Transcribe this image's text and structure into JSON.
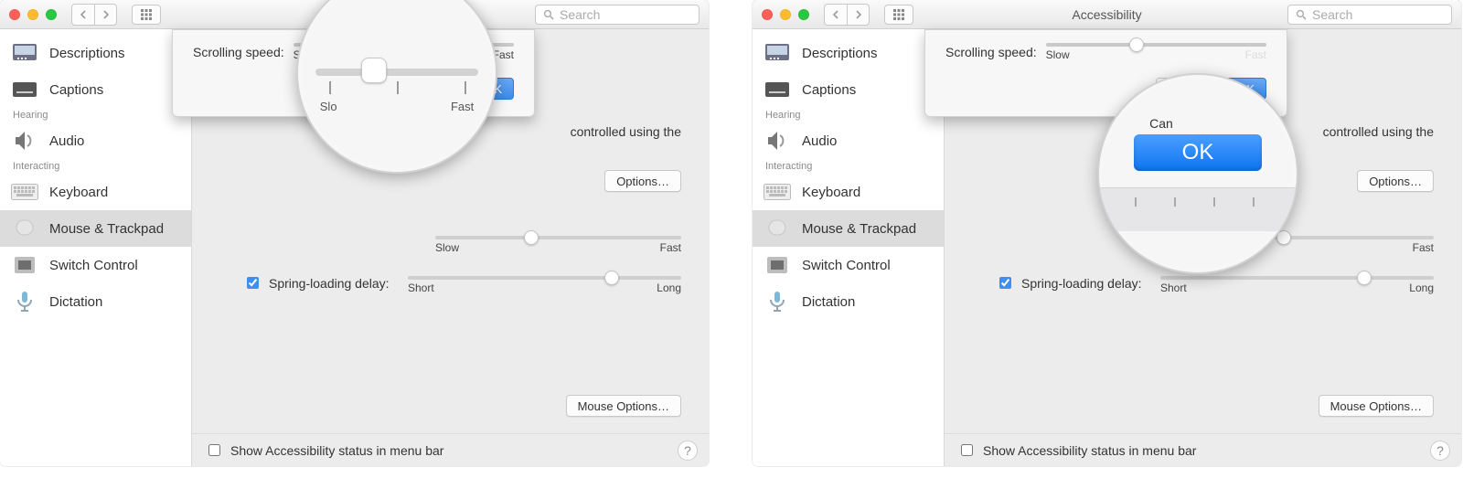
{
  "window": {
    "title": "Accessibility",
    "title_truncated": "Ac",
    "search_placeholder": "Search"
  },
  "sidebar": {
    "items": [
      {
        "label": "Descriptions"
      },
      {
        "label": "Captions"
      }
    ],
    "hearing_heading": "Hearing",
    "audio_label": "Audio",
    "interacting_heading": "Interacting",
    "keyboard_label": "Keyboard",
    "mouse_label": "Mouse & Trackpad",
    "switch_label": "Switch Control",
    "dictation_label": "Dictation"
  },
  "content": {
    "info_tail": "controlled using the",
    "options_label": "Options…",
    "double_click": {
      "slow": "Slow",
      "fast": "Fast",
      "value_pct": 36
    },
    "spring_label": "Spring-loading delay:",
    "spring": {
      "short": "Short",
      "long": "Long",
      "value_pct": 72,
      "checked": true
    },
    "mouse_options_label": "Mouse Options…"
  },
  "sheet": {
    "label": "Scrolling speed:",
    "slow": "Slow",
    "fast": "Fast",
    "cancel": "Cancel",
    "ok": "OK",
    "value_left_pct": 36,
    "value_right_pct": 38
  },
  "footer": {
    "label": "Show Accessibility status in menu bar",
    "checked": false
  },
  "lens": {
    "slow": "Slo",
    "fast": "Fast",
    "ok": "OK",
    "can": "Can"
  }
}
